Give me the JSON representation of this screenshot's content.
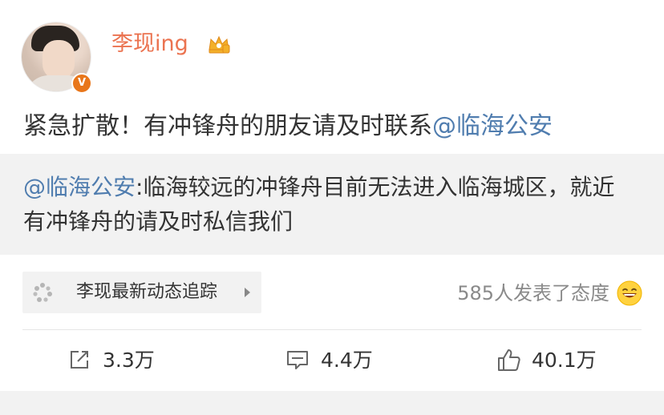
{
  "post": {
    "username": "李现ing",
    "text_before_mention": "紧急扩散！有冲锋舟的朋友请及时联系",
    "mention": "@临海公安"
  },
  "repost": {
    "mention": "@临海公安",
    "text": ":临海较远的冲锋舟目前无法进入临海城区，就近有冲锋舟的请及时私信我们"
  },
  "tracker": {
    "label": "李现最新动态追踪"
  },
  "attitude": {
    "text": "585人发表了态度"
  },
  "actions": {
    "repost_count": "3.3万",
    "comment_count": "4.4万",
    "like_count": "40.1万"
  },
  "colors": {
    "username": "#eb7350",
    "mention": "#507daf",
    "badge": "#e8761a"
  },
  "icons": [
    "crown-icon",
    "verified-icon",
    "dots-icon",
    "chevron-right-icon",
    "laugh-emoji-icon",
    "repost-icon",
    "comment-icon",
    "like-icon"
  ]
}
